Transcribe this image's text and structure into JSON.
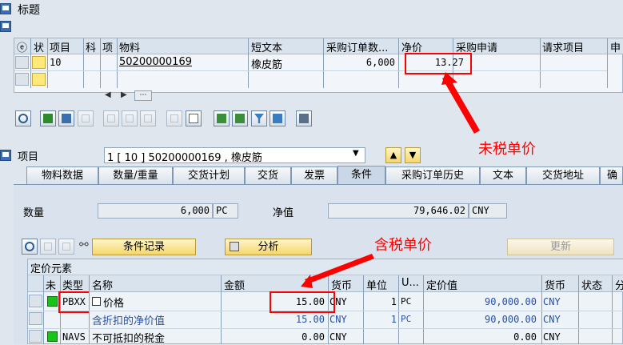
{
  "header": {
    "title": "标题"
  },
  "top_table": {
    "columns": [
      "ⓔ",
      "状",
      "项目",
      "科",
      "项",
      "物料",
      "短文本",
      "采购订单数...",
      "净价",
      "采购申请",
      "请求项目",
      "申"
    ],
    "rows": [
      {
        "item": "10",
        "material": "50200000169",
        "short_text": "橡皮筋",
        "po_qty": "6,000",
        "net_price": "13.27"
      }
    ]
  },
  "item_section": {
    "label": "项目",
    "selector_value": "1 [ 10 ] 50200000169 , 橡皮筋"
  },
  "tabs": [
    {
      "label": "物料数据"
    },
    {
      "label": "数量/重量"
    },
    {
      "label": "交货计划"
    },
    {
      "label": "交货"
    },
    {
      "label": "发票"
    },
    {
      "label": "条件"
    },
    {
      "label": "采购订单历史"
    },
    {
      "label": "文本"
    },
    {
      "label": "交货地址"
    },
    {
      "label": "确"
    }
  ],
  "condition": {
    "qty_label": "数量",
    "qty_value": "6,000",
    "qty_unit": "PC",
    "net_label": "净值",
    "net_value": "79,646.02",
    "net_currency": "CNY",
    "cond_record_btn": "条件记录",
    "analysis_btn": "分析",
    "update_btn": "更新"
  },
  "pricing": {
    "title": "定价元素",
    "columns": [
      "未",
      "类型",
      "名称",
      "金额",
      "货币",
      "单位",
      "U...",
      "定价值",
      "货币",
      "状态",
      "分"
    ],
    "rows": [
      {
        "type": "PBXX",
        "name": "价格",
        "amount": "15.00",
        "currency": "CNY",
        "unit": "1",
        "uom": "PC",
        "value": "90,000.00",
        "currency2": "CNY"
      },
      {
        "type": "",
        "name": "含折扣的净价值",
        "amount": "15.00",
        "currency": "CNY",
        "unit": "1",
        "uom": "PC",
        "value": "90,000.00",
        "currency2": "CNY"
      },
      {
        "type": "NAVS",
        "name": "不可抵扣的税金",
        "amount": "0.00",
        "currency": "CNY",
        "unit": "",
        "uom": "",
        "value": "0.00",
        "currency2": "CNY"
      }
    ]
  },
  "annotations": {
    "no_tax_price": "未税单价",
    "tax_price": "含税单价",
    "color": "#ff0000"
  }
}
